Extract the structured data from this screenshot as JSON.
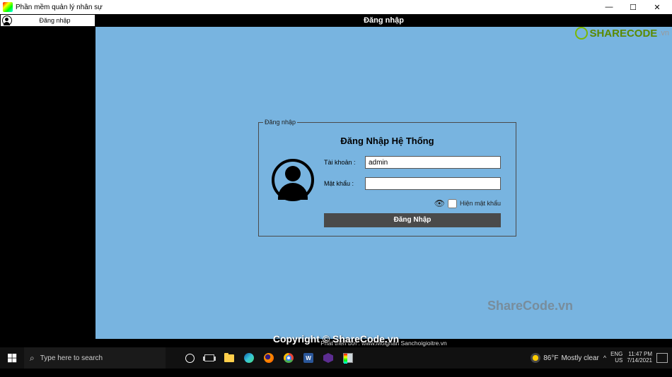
{
  "window": {
    "title": "Phần mềm quản lý nhân sự",
    "min": "—",
    "max": "☐",
    "close": "✕"
  },
  "sidebar_tab": {
    "label": "Đăng nhập"
  },
  "app_header": "Đăng nhập",
  "login": {
    "legend": "Đăng nhập",
    "heading": "Đăng Nhập Hệ Thống",
    "account_label": "Tài khoản :",
    "account_value": "admin",
    "password_label": "Mật khẩu :",
    "password_value": "",
    "show_pw_label": "Hiện mật khẩu",
    "button": "Đăng Nhập"
  },
  "footnote": "Phát triển bởi :  www.Moighan Sanchoigioitre.vn",
  "watermark": {
    "logo_text": "SHARECODE",
    "logo_suffix": ".vn",
    "center": "ShareCode.vn",
    "copyright": "Copyright © ShareCode.vn"
  },
  "taskbar": {
    "search_placeholder": "Type here to search",
    "weather_temp": "86°F",
    "weather_cond": "Mostly clear",
    "lang_top": "ENG",
    "lang_bot": "US",
    "time": "11:47 PM",
    "date": "7/14/2021"
  }
}
